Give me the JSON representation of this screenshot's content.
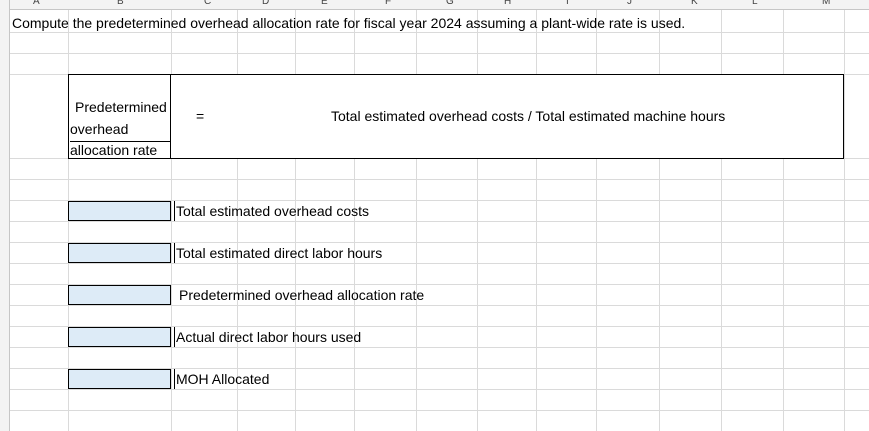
{
  "columns": [
    "A",
    "B",
    "C",
    "D",
    "E",
    "F",
    "G",
    "H",
    "I",
    "J",
    "K",
    "L",
    "M"
  ],
  "instruction": "Compute the predetermined overhead allocation rate for fiscal year 2024 assuming a plant-wide rate is used.",
  "formula": {
    "label_line1": "Predetermined",
    "label_line2": "overhead",
    "label_line3": "allocation rate",
    "equals": "=",
    "expression": "Total estimated overhead costs / Total estimated machine hours"
  },
  "inputs": [
    {
      "label": "Total estimated overhead costs",
      "value": ""
    },
    {
      "label": "Total estimated direct labor hours",
      "value": ""
    },
    {
      "label": "Predetermined overhead allocation rate",
      "value": ""
    },
    {
      "label": "Actual direct labor hours used",
      "value": ""
    },
    {
      "label": "MOH Allocated",
      "value": ""
    }
  ],
  "colors": {
    "input_fill": "#ddebf7",
    "grid": "#dadada"
  }
}
